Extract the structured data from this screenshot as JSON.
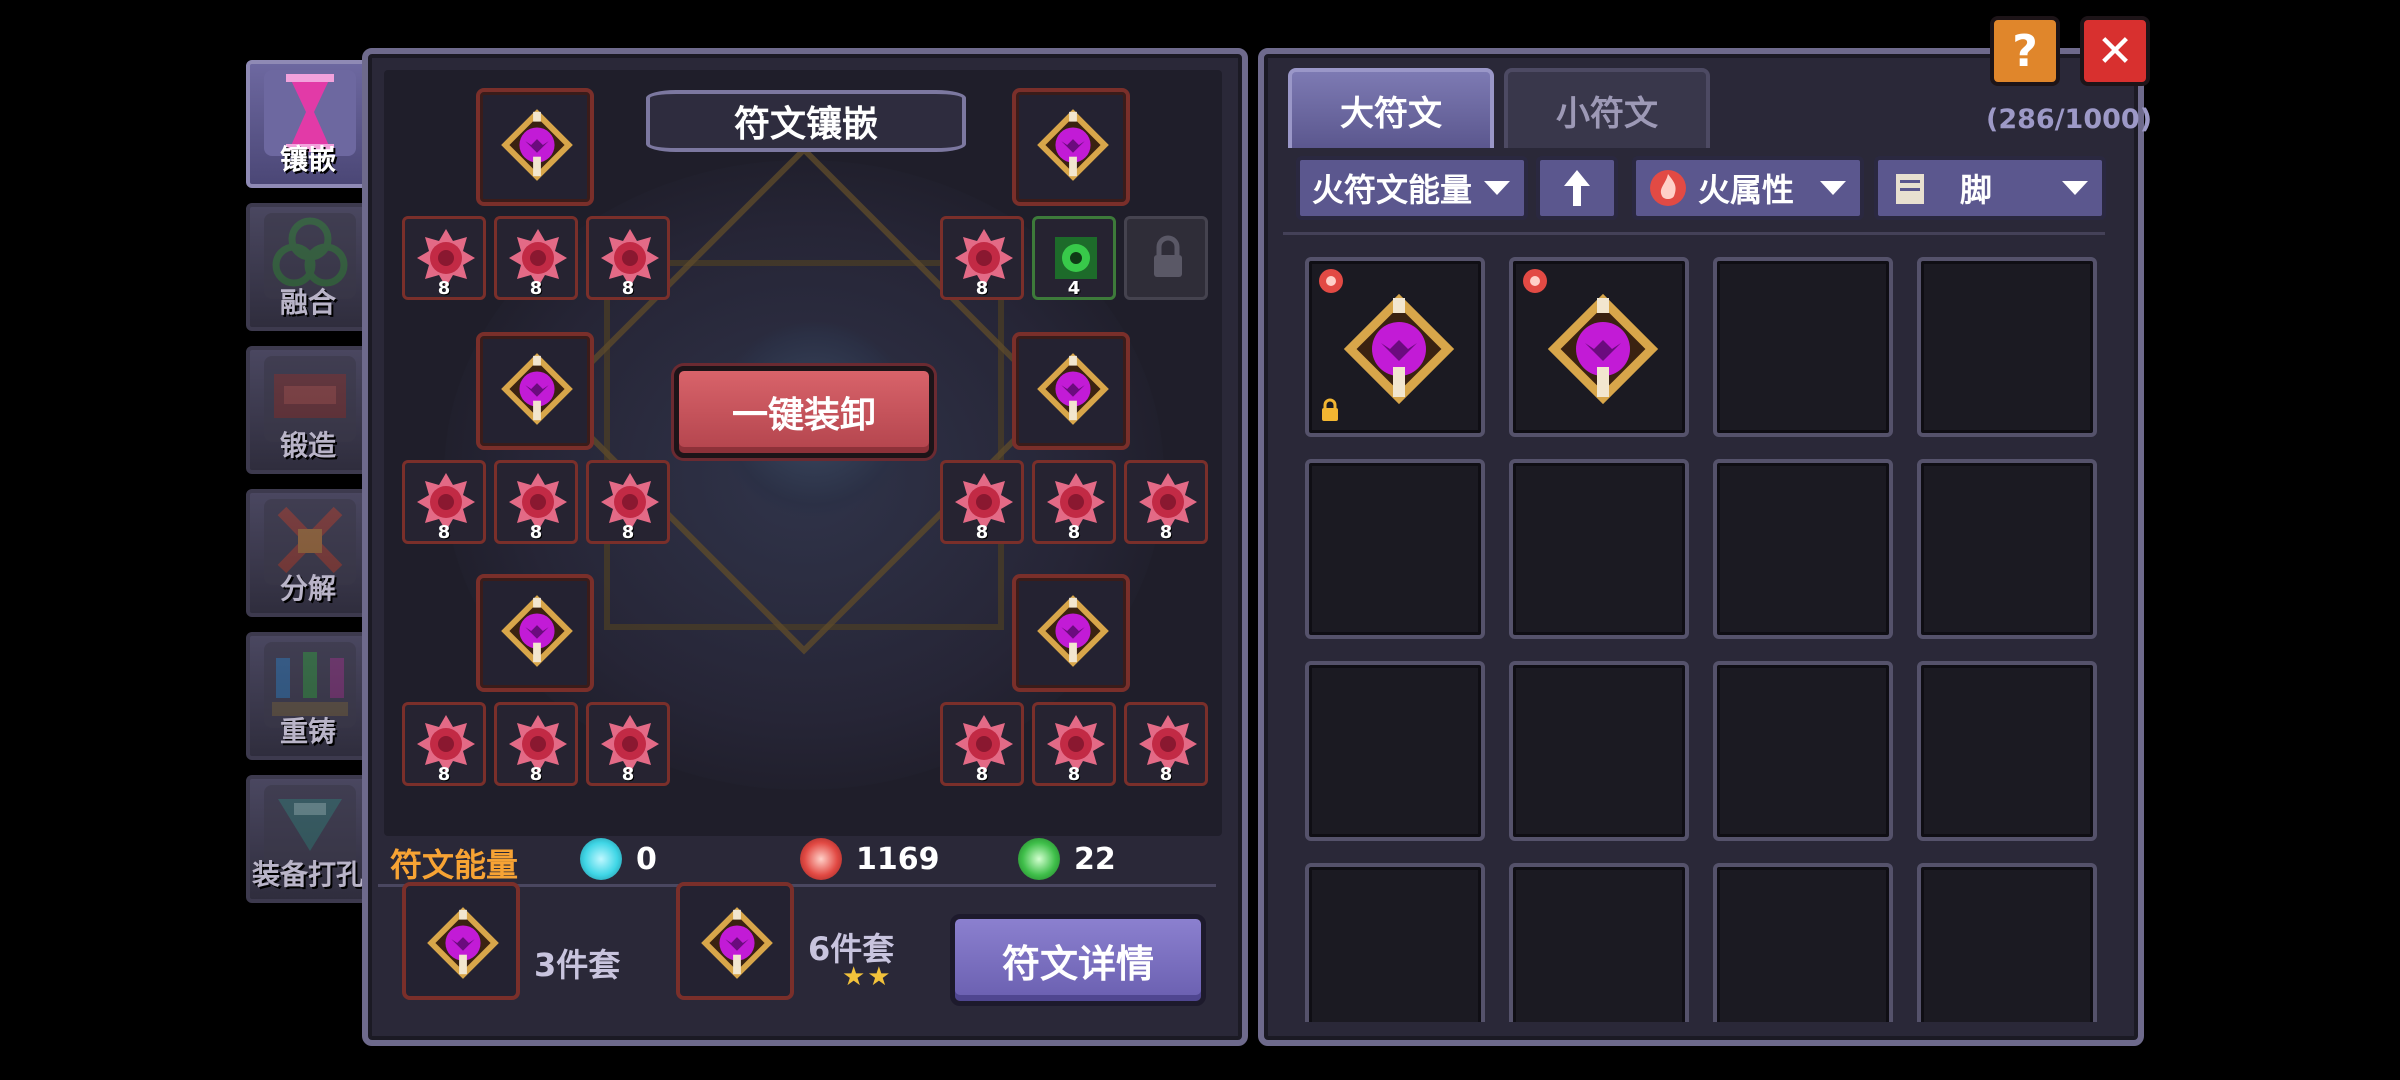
{
  "side_tabs": [
    {
      "label": "镶嵌",
      "active": true
    },
    {
      "label": "融合",
      "active": false
    },
    {
      "label": "锻造",
      "active": false
    },
    {
      "label": "分解",
      "active": false
    },
    {
      "label": "重铸",
      "active": false
    },
    {
      "label": "装备打孔",
      "active": false
    }
  ],
  "board": {
    "title": "符文镶嵌",
    "unequip_button": "一键装卸",
    "small_rune_levels": {
      "row1_left": [
        "8",
        "8",
        "8"
      ],
      "row1_right": [
        "8",
        "4"
      ],
      "row2_left": [
        "8",
        "8",
        "8"
      ],
      "row2_right": [
        "8",
        "8",
        "8"
      ],
      "row3_left": [
        "8",
        "8",
        "8"
      ],
      "row3_right": [
        "8",
        "8",
        "8"
      ]
    }
  },
  "energy": {
    "title": "符文能量",
    "items": [
      {
        "icon": "ice-energy-icon",
        "value": "0",
        "color": "#3fd6e6"
      },
      {
        "icon": "fire-energy-icon",
        "value": "1169",
        "color": "#e24a44"
      },
      {
        "icon": "nature-energy-icon",
        "value": "22",
        "color": "#3fbf4a"
      }
    ]
  },
  "sets": {
    "set1_label": "3件套",
    "set2_label": "6件套",
    "set2_stars": "★★",
    "detail_button": "符文详情"
  },
  "inventory": {
    "tabs": [
      "大符文",
      "小符文"
    ],
    "count": "(286/1000)",
    "filters": {
      "sort": "火符文能量",
      "sort_direction_icon": "arrow-up-icon",
      "element": "火属性",
      "slot": "脚"
    }
  },
  "colors": {
    "rune_magenta": "#c21bd6",
    "rune_gold": "#d8a64a",
    "rose_red": "#d8455c",
    "help_button": "#e0862b",
    "close_button": "#d8302f"
  },
  "header_buttons": {
    "help": "?",
    "close": "✕"
  }
}
